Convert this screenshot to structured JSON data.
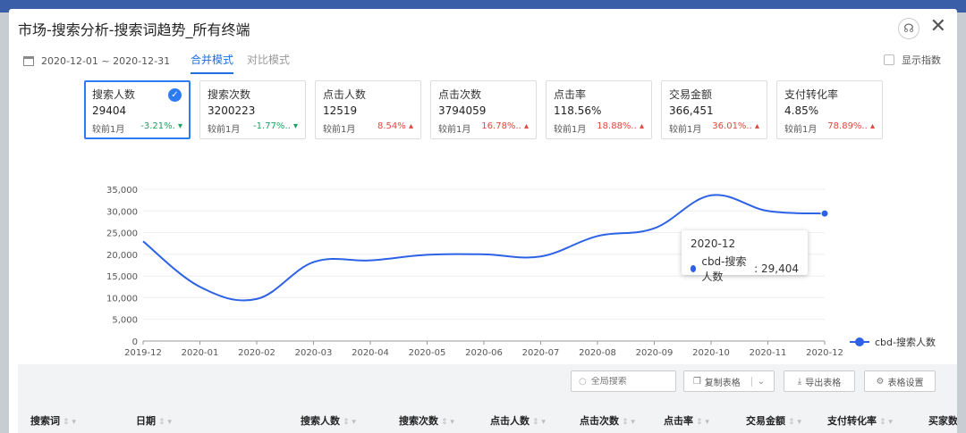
{
  "window": {
    "title": "市场-搜索分析-搜索词趋势_所有终端"
  },
  "toolbar": {
    "date_range": "2020-12-01 ~ 2020-12-31",
    "tabs": [
      {
        "label": "合并模式",
        "active": true
      },
      {
        "label": "对比模式",
        "active": false
      }
    ],
    "show_index_label": "显示指数"
  },
  "metrics": [
    {
      "label": "搜索人数",
      "value": "29404",
      "compare": "较前1月",
      "change": "-3.21%.",
      "dir": "down",
      "selected": true
    },
    {
      "label": "搜索次数",
      "value": "3200223",
      "compare": "较前1月",
      "change": "-1.77%..",
      "dir": "down",
      "selected": false
    },
    {
      "label": "点击人数",
      "value": "12519",
      "compare": "较前1月",
      "change": "8.54%",
      "dir": "up",
      "selected": false
    },
    {
      "label": "点击次数",
      "value": "3794059",
      "compare": "较前1月",
      "change": "16.78%..",
      "dir": "up",
      "selected": false
    },
    {
      "label": "点击率",
      "value": "118.56%",
      "compare": "较前1月",
      "change": "18.88%..",
      "dir": "up",
      "selected": false
    },
    {
      "label": "交易金额",
      "value": "366,451",
      "compare": "较前1月",
      "change": "36.01%..",
      "dir": "up",
      "selected": false
    },
    {
      "label": "支付转化率",
      "value": "4.85%",
      "compare": "较前1月",
      "change": "78.89%..",
      "dir": "up",
      "selected": false
    }
  ],
  "colors": {
    "accent": "#2d7bf4",
    "series": "#2d62e6",
    "down": "#1aa260",
    "up": "#e0463b"
  },
  "chart_data": {
    "type": "line",
    "x": [
      "2019-12",
      "2020-01",
      "2020-02",
      "2020-03",
      "2020-04",
      "2020-05",
      "2020-06",
      "2020-07",
      "2020-08",
      "2020-09",
      "2020-10",
      "2020-11",
      "2020-12"
    ],
    "series": [
      {
        "name": "cbd-搜索人数",
        "values": [
          23000,
          12500,
          9700,
          18200,
          18600,
          19900,
          20000,
          19500,
          24200,
          26000,
          33600,
          30000,
          29404
        ]
      }
    ],
    "yticks": [
      "0",
      "5,000",
      "10,000",
      "15,000",
      "20,000",
      "25,000",
      "30,000",
      "35,000"
    ],
    "ylim": [
      0,
      35000
    ],
    "grid": true,
    "legend": "right"
  },
  "tooltip": {
    "title": "2020-12",
    "series": "cbd-搜索人数",
    "value": "29,404"
  },
  "table_tools": {
    "search_placeholder": "全局搜索",
    "copy_label": "复制表格",
    "export_label": "导出表格",
    "settings_label": "表格设置"
  },
  "table": {
    "columns": [
      "搜索词",
      "日期",
      "搜索人数",
      "搜索次数",
      "点击人数",
      "点击次数",
      "点击率",
      "交易金额",
      "支付转化率",
      "买家数"
    ]
  }
}
